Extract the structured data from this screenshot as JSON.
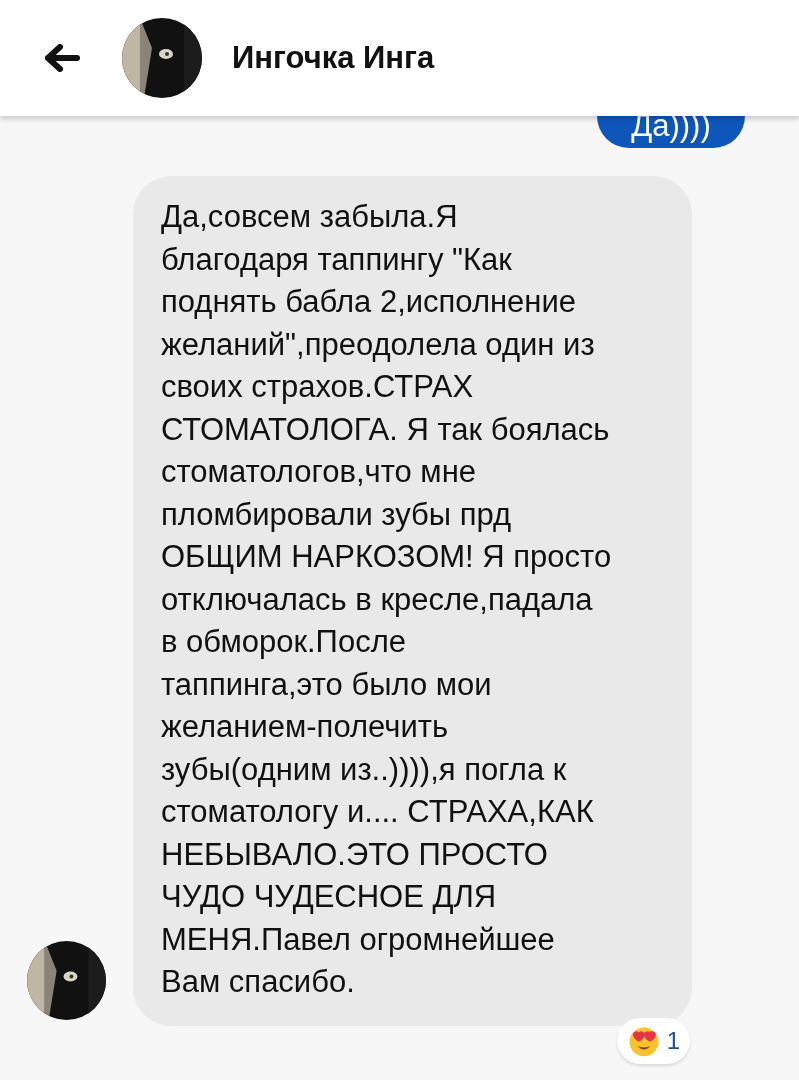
{
  "header": {
    "title": "Ингочка Инга"
  },
  "messages": [
    {
      "kind": "outgoing",
      "text": "Да))))"
    },
    {
      "kind": "incoming",
      "text": "Да,совсем забыла.Я\nблагодаря таппингу \"Как\nподнять бабла 2,исполнение\nжеланий\",преодолела один из\nсвоих страхов.СТРАХ\nСТОМАТОЛОГА. Я так боялась\nстоматологов,что мне\nпломбировали зубы прд\nОБЩИМ НАРКОЗОМ! Я просто\nотключалась в кресле,падала\nв обморок.После\nтаппинга,это было мои\nжеланием-полечить\nзубы(одним из..)))),я погла к\nстоматологу и.... СТРАХА,КАК\nНЕБЫВАЛО.ЭТО ПРОСТО\nЧУДО ЧУДЕСНОЕ ДЛЯ\nМЕНЯ.Павел огромнейшее\nВам спасибо.",
      "reaction": {
        "count": "1"
      }
    }
  ]
}
